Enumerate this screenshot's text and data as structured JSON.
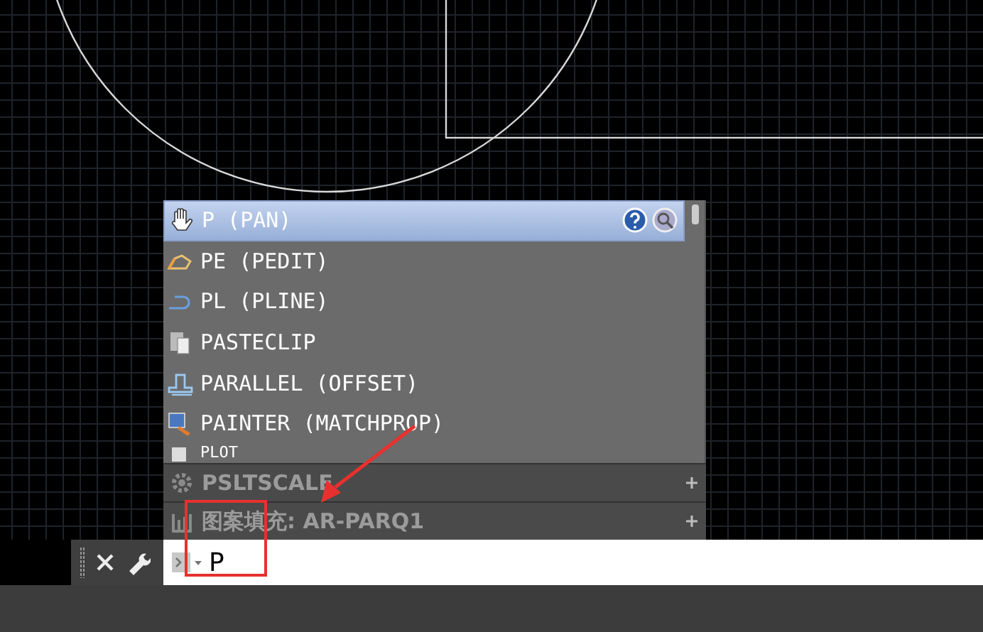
{
  "suggestions": [
    {
      "label": "P (PAN)",
      "selected": true
    },
    {
      "label": "PE (PEDIT)",
      "selected": false
    },
    {
      "label": "PL (PLINE)",
      "selected": false
    },
    {
      "label": "PASTECLIP",
      "selected": false
    },
    {
      "label": "PARALLEL (OFFSET)",
      "selected": false
    },
    {
      "label": "PAINTER (MATCHPROP)",
      "selected": false
    },
    {
      "label": "PLOT",
      "selected": false
    }
  ],
  "sections": [
    {
      "label": "PSLTSCALE"
    },
    {
      "label": "图案填充: AR-PARQ1"
    }
  ],
  "command_line": {
    "value": "P"
  }
}
